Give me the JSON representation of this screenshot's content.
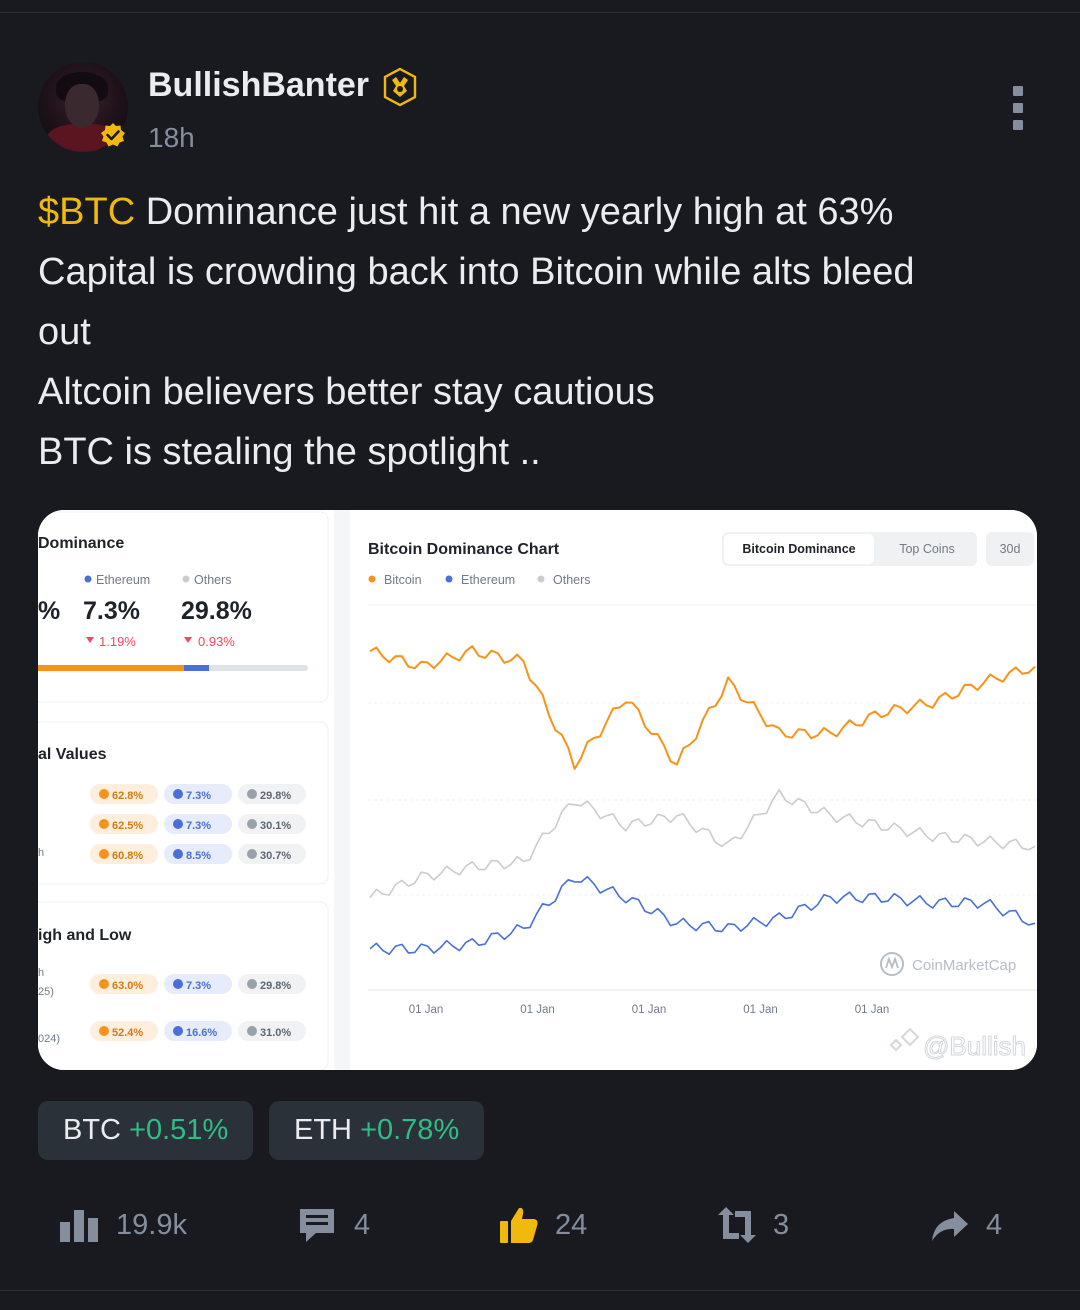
{
  "header": {
    "username": "BullishBanter",
    "time": "18h"
  },
  "post": {
    "cashtag": "$BTC",
    "line1_rest": " Dominance just hit a new yearly high at 63%",
    "line2": "Capital is crowding back into Bitcoin while alts bleed",
    "line3": "out",
    "line4": "Altcoin believers better stay cautious",
    "line5": "BTC is stealing the spotlight .."
  },
  "image": {
    "left_panel": {
      "dominance_title": "Dominance",
      "legend": [
        "Ethereum",
        "Others"
      ],
      "cut_prefix": "%",
      "values": [
        "7.3%",
        "29.8%"
      ],
      "changes": [
        "1.19%",
        "0.93%"
      ],
      "historical_title": "al Values",
      "historical_row_prefix": "h",
      "historical_rows": [
        [
          "62.8%",
          "7.3%",
          "29.8%"
        ],
        [
          "62.5%",
          "7.3%",
          "30.1%"
        ],
        [
          "60.8%",
          "8.5%",
          "30.7%"
        ]
      ],
      "highlow_title": "igh and Low",
      "highlow_rows": [
        {
          "label_a": "h",
          "label_b": "25)",
          "values": [
            "63.0%",
            "7.3%",
            "29.8%"
          ]
        },
        {
          "label_a": "",
          "label_b": "024)",
          "values": [
            "52.4%",
            "16.6%",
            "31.0%"
          ]
        }
      ]
    },
    "chart": {
      "title": "Bitcoin Dominance Chart",
      "tabs": [
        "Bitcoin Dominance",
        "Top Coins",
        "30d"
      ],
      "legend": [
        "Bitcoin",
        "Ethereum",
        "Others"
      ],
      "x_labels": [
        "01 Jan",
        "01 Jan",
        "01 Jan",
        "01 Jan",
        "01 Jan"
      ],
      "source_watermark": "CoinMarketCap",
      "user_watermark": "@Bullish",
      "colors": {
        "bitcoin": "#f7931a",
        "ethereum": "#4a6fd8",
        "others": "#c9ccd1"
      }
    }
  },
  "chart_data": {
    "type": "line",
    "title": "Bitcoin Dominance Chart",
    "x": [
      "01 Jan",
      "01 Jan",
      "01 Jan",
      "01 Jan",
      "01 Jan"
    ],
    "series": [
      {
        "name": "Bitcoin",
        "values": [
          66,
          63,
          66,
          64,
          44,
          57,
          44,
          60,
          50,
          50,
          54,
          56,
          60,
          63
        ]
      },
      {
        "name": "Ethereum",
        "values": [
          8,
          8,
          9,
          12,
          22,
          18,
          13,
          12,
          14,
          18,
          18,
          17,
          17,
          13
        ]
      },
      {
        "name": "Others",
        "values": [
          18,
          22,
          24,
          25,
          37,
          32,
          34,
          28,
          38,
          34,
          32,
          30,
          29,
          28
        ]
      }
    ]
  },
  "tickers": [
    {
      "symbol": "BTC",
      "change": "+0.51%"
    },
    {
      "symbol": "ETH",
      "change": "+0.78%"
    }
  ],
  "actions": {
    "views": "19.9k",
    "comments": "4",
    "likes": "24",
    "reposts": "3",
    "shares": "4"
  }
}
